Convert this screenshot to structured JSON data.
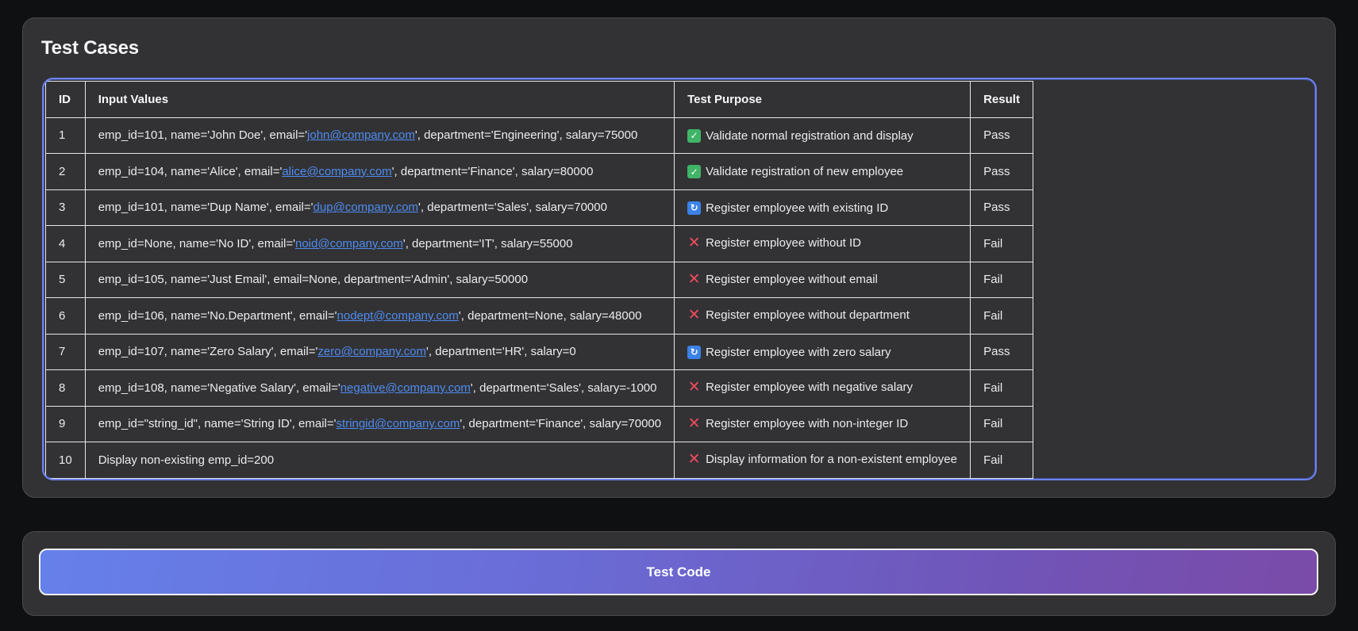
{
  "section": {
    "title": "Test Cases"
  },
  "table": {
    "headers": [
      "ID",
      "Input Values",
      "Test Purpose",
      "Result"
    ],
    "rows": [
      {
        "id": "1",
        "input_pre": "emp_id=101, name='John Doe', email='",
        "email": "john@company.com",
        "input_post": "', department='Engineering', salary=75000",
        "icon": "check-icon",
        "purpose": "Validate normal registration and display",
        "result": "Pass"
      },
      {
        "id": "2",
        "input_pre": "emp_id=104, name='Alice', email='",
        "email": "alice@company.com",
        "input_post": "', department='Finance', salary=80000",
        "icon": "check-icon",
        "purpose": "Validate registration of new employee",
        "result": "Pass"
      },
      {
        "id": "3",
        "input_pre": "emp_id=101, name='Dup Name', email='",
        "email": "dup@company.com",
        "input_post": "', department='Sales', salary=70000",
        "icon": "repeat-icon",
        "purpose": "Register employee with existing ID",
        "result": "Pass"
      },
      {
        "id": "4",
        "input_pre": "emp_id=None, name='No ID', email='",
        "email": "noid@company.com",
        "input_post": "', department='IT', salary=55000",
        "icon": "cross-icon",
        "purpose": "Register employee without ID",
        "result": "Fail"
      },
      {
        "id": "5",
        "input_pre": "emp_id=105, name='Just Email', email=None, department='Admin', salary=50000",
        "email": "",
        "input_post": "",
        "icon": "cross-icon",
        "purpose": "Register employee without email",
        "result": "Fail"
      },
      {
        "id": "6",
        "input_pre": "emp_id=106, name='No.Department', email='",
        "email": "nodept@company.com",
        "input_post": "', department=None, salary=48000",
        "icon": "cross-icon",
        "purpose": "Register employee without department",
        "result": "Fail"
      },
      {
        "id": "7",
        "input_pre": "emp_id=107, name='Zero Salary', email='",
        "email": "zero@company.com",
        "input_post": "', department='HR', salary=0",
        "icon": "repeat-icon",
        "purpose": "Register employee with zero salary",
        "result": "Pass"
      },
      {
        "id": "8",
        "input_pre": "emp_id=108, name='Negative Salary', email='",
        "email": "negative@company.com",
        "input_post": "', department='Sales', salary=-1000",
        "icon": "cross-icon",
        "purpose": "Register employee with negative salary",
        "result": "Fail"
      },
      {
        "id": "9",
        "input_pre": "emp_id=\"string_id\", name='String ID', email='",
        "email": "stringid@company.com",
        "input_post": "', department='Finance', salary=70000",
        "icon": "cross-icon",
        "purpose": "Register employee with non-integer ID",
        "result": "Fail"
      },
      {
        "id": "10",
        "input_pre": "Display non-existing emp_id=200",
        "email": "",
        "input_post": "",
        "icon": "cross-icon",
        "purpose": "Display information for a non-existent employee",
        "result": "Fail"
      }
    ]
  },
  "actions": {
    "test_code_label": "Test Code"
  },
  "colors": {
    "accent_border": "#6e83ee",
    "link": "#4f8cf0",
    "button_gradient_start": "#6680ea",
    "button_gradient_end": "#7a4ba8",
    "pass_icon": "#3fb466",
    "fail_icon": "#f04a5e",
    "repeat_icon": "#3b82e8"
  }
}
